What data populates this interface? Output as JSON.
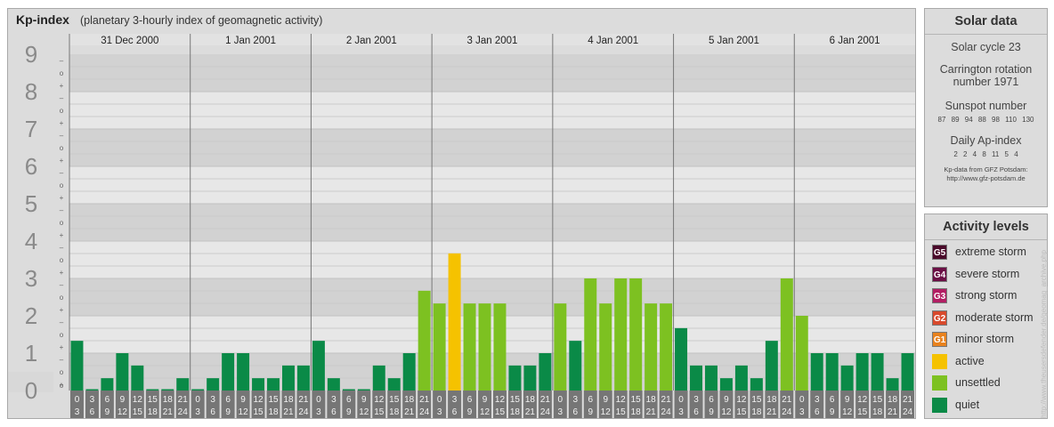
{
  "header": {
    "title": "Kp-index",
    "subtitle": "(planetary 3-hourly index of geomagnetic activity)"
  },
  "solar": {
    "heading": "Solar data",
    "cycle": "Solar cycle 23",
    "carrington_line1": "Carrington rotation",
    "carrington_line2": "number 1971",
    "sunspot_label": "Sunspot number",
    "sunspot_values": "87 89 94 88 98 110 130",
    "ap_label": "Daily Ap-index",
    "ap_values": "2 2 4 8 11 5 4",
    "credit_line1": "Kp-data from GFZ Potsdam:",
    "credit_line2": "http://www.gfz-potsdam.de"
  },
  "activity": {
    "heading": "Activity levels",
    "levels": [
      {
        "code": "G5",
        "label": "extreme storm",
        "color": "#4a0a2a"
      },
      {
        "code": "G4",
        "label": "severe storm",
        "color": "#6b0f45"
      },
      {
        "code": "G3",
        "label": "strong storm",
        "color": "#b21e63"
      },
      {
        "code": "G2",
        "label": "moderate storm",
        "color": "#d8492c"
      },
      {
        "code": "G1",
        "label": "minor storm",
        "color": "#e8821e"
      },
      {
        "code": "",
        "label": "active",
        "color": "#f5c200"
      },
      {
        "code": "",
        "label": "unsettled",
        "color": "#7dc121"
      },
      {
        "code": "",
        "label": "quiet",
        "color": "#0a8a47"
      }
    ]
  },
  "watermark": "http://www.theusersdefender.de/geomag_archive.php",
  "chart_data": {
    "type": "bar",
    "title": "Kp-index",
    "subtitle": "(planetary 3-hourly index of geomagnetic activity)",
    "ylim": [
      0,
      9
    ],
    "y_major_labels": [
      "0",
      "1",
      "2",
      "3",
      "4",
      "5",
      "6",
      "7",
      "8",
      "9"
    ],
    "y_minor_labels": [
      "+",
      "o",
      "–"
    ],
    "days": [
      "31 Dec 2000",
      "1 Jan 2001",
      "2 Jan 2001",
      "3 Jan 2001",
      "4 Jan 2001",
      "5 Jan 2001",
      "6 Jan 2001"
    ],
    "hour_top": [
      "0",
      "3",
      "6",
      "9",
      "12",
      "15",
      "18",
      "21"
    ],
    "hour_bottom": [
      "3",
      "6",
      "9",
      "12",
      "15",
      "18",
      "21",
      "24"
    ],
    "values": [
      1.33,
      0,
      0.33,
      1,
      0.67,
      0,
      0,
      0.33,
      0,
      0.33,
      1,
      1,
      0.33,
      0.33,
      0.67,
      0.67,
      1.33,
      0.33,
      0,
      0,
      0.67,
      0.33,
      1,
      2.67,
      2.33,
      3.67,
      2.33,
      2.33,
      2.33,
      0.67,
      0.67,
      1,
      2.33,
      1.33,
      3,
      2.33,
      3,
      3,
      2.33,
      2.33,
      1.67,
      0.67,
      0.67,
      0.33,
      0.67,
      0.33,
      1.33,
      3,
      2,
      1,
      1,
      0.67,
      1,
      1,
      0.33,
      1
    ],
    "colors": {
      "quiet": "#0a8a47",
      "unsettled": "#7dc121",
      "active": "#f5c200"
    },
    "grid": true
  }
}
